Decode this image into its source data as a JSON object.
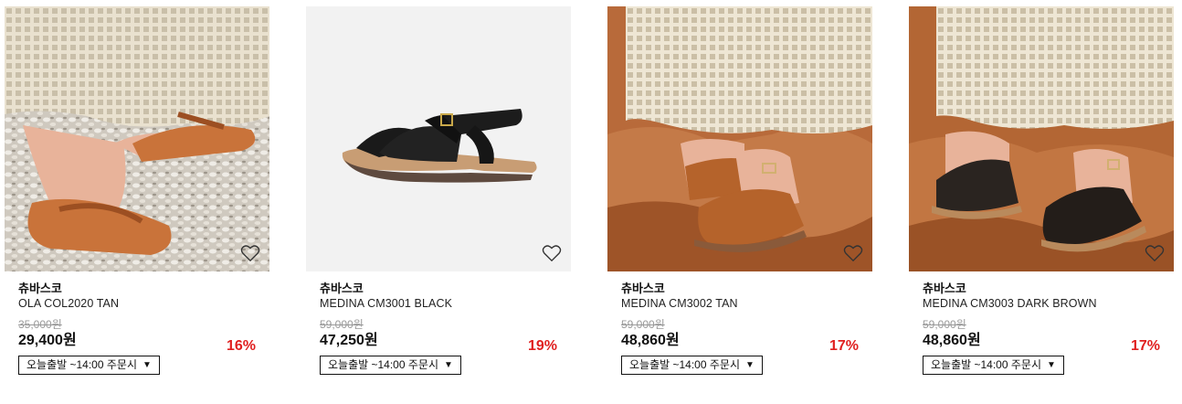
{
  "products": [
    {
      "brand": "츄바스코",
      "name": "OLA COL2020 TAN",
      "original_price": "35,000원",
      "price": "29,400원",
      "discount": "16%",
      "shipping_option": "오늘출발 ~14:00 주문시",
      "image": "orange-flip-flop-on-shells",
      "wishlist_icon": "heart-outline-icon"
    },
    {
      "brand": "츄바스코",
      "name": "MEDINA CM3001 BLACK",
      "original_price": "59,000원",
      "price": "47,250원",
      "discount": "19%",
      "shipping_option": "오늘출발 ~14:00 주문시",
      "image": "black-sandal-white-background",
      "wishlist_icon": "heart-outline-icon"
    },
    {
      "brand": "츄바스코",
      "name": "MEDINA CM3002 TAN",
      "original_price": "59,000원",
      "price": "48,860원",
      "discount": "17%",
      "shipping_option": "오늘출발 ~14:00 주문시",
      "image": "tan-sandal-on-rocks",
      "wishlist_icon": "heart-outline-icon"
    },
    {
      "brand": "츄바스코",
      "name": "MEDINA CM3003 DARK BROWN",
      "original_price": "59,000원",
      "price": "48,860원",
      "discount": "17%",
      "shipping_option": "오늘출발 ~14:00 주문시",
      "image": "dark-sandal-on-rocks",
      "wishlist_icon": "heart-outline-icon"
    }
  ],
  "colors": {
    "discount": "#e02020",
    "strike_price": "#999999",
    "text": "#111111"
  }
}
